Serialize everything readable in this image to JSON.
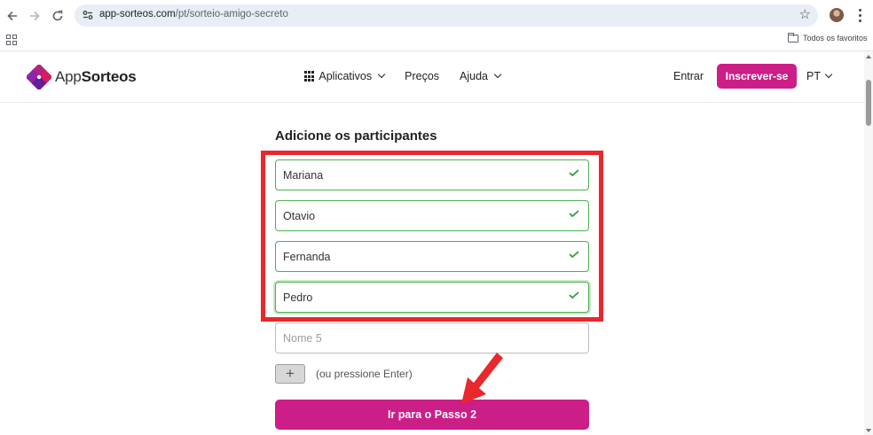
{
  "browser": {
    "url_host": "app-sorteos.com",
    "url_path": "/pt/sorteio-amigo-secreto",
    "bookmarks_label": "Todos os favoritos"
  },
  "header": {
    "logo_prefix": "App",
    "logo_suffix": "Sorteos",
    "nav": {
      "apps": "Aplicativos",
      "pricing": "Preços",
      "help": "Ajuda"
    },
    "login": "Entrar",
    "signup": "Inscrever-se",
    "language": "PT"
  },
  "form": {
    "title": "Adicione os participantes",
    "participants": [
      "Mariana",
      "Otavio",
      "Fernanda",
      "Pedro"
    ],
    "new_participant_placeholder": "Nome 5",
    "add_button": "+",
    "hint": "(ou pressione Enter)",
    "next_button": "Ir para o Passo 2"
  },
  "colors": {
    "brand": "#cc1e87",
    "valid": "#4caf50",
    "highlight": "#e8282b"
  },
  "icons": [
    "back-arrow-icon",
    "forward-arrow-icon",
    "reload-icon",
    "site-info-icon",
    "star-icon",
    "apps-grid-icon",
    "folder-icon",
    "chevron-down-icon",
    "check-icon",
    "plus-icon"
  ]
}
